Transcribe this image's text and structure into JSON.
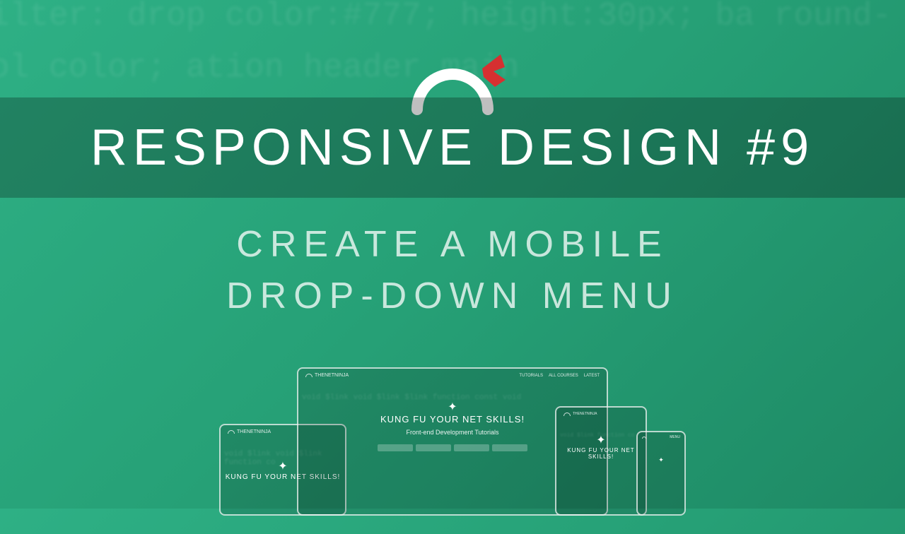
{
  "title": "RESPONSIVE DESIGN #9",
  "subtitle_line1": "CREATE A MOBILE",
  "subtitle_line2": "DROP-DOWN MENU",
  "devices": {
    "brand": "THENETNINJA",
    "hero_title": "KUNG FU YOUR NET SKILLS!",
    "hero_subtitle": "Front-end Development Tutorials",
    "nav_items": [
      "TUTORIALS",
      "ALL COURSES",
      "LATEST"
    ],
    "phone_menu": "MENU"
  },
  "bg_code_snippet": "filter: drop\ncolor:#777;\n\nheight:30px;\nba    round-col\ncolor;   ation\n\nheader main"
}
